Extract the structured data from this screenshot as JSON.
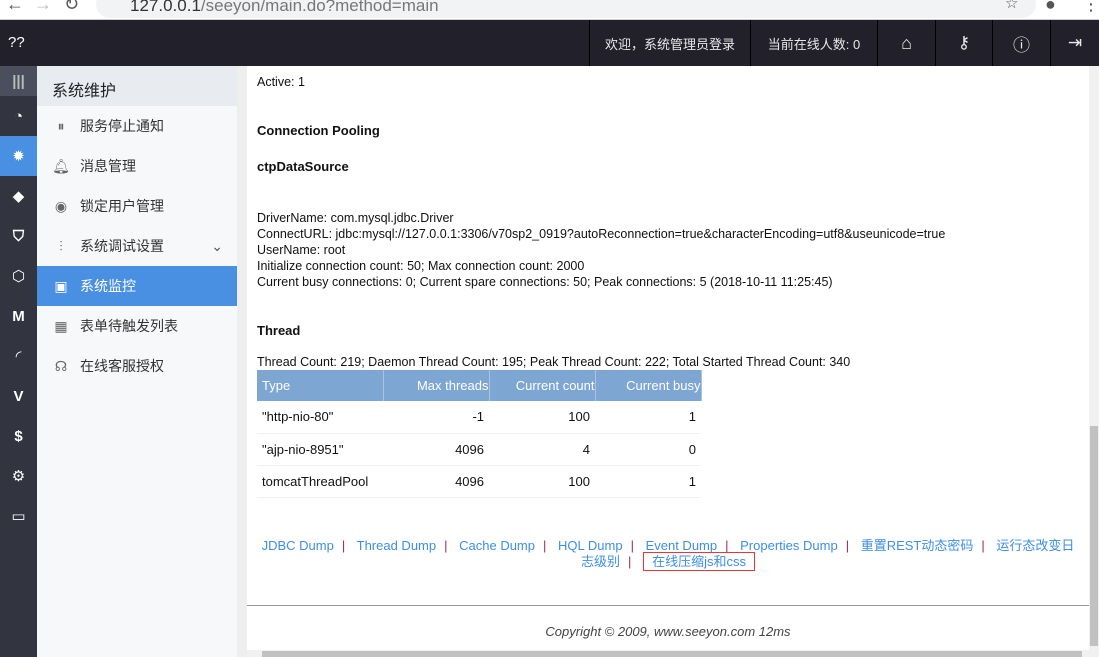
{
  "browser": {
    "url_host": "127.0.0.1",
    "url_path": "/seeyon/main.do?method=main"
  },
  "topbar": {
    "logo": "??",
    "welcome": "欢迎，系统管理员登录",
    "online": "当前在线人数: 0",
    "icons": [
      "home-icon",
      "key-icon",
      "help-icon",
      "logout-icon"
    ]
  },
  "rail": {
    "icons": [
      "menu-icon",
      "dashboard-icon",
      "gear-icon",
      "plugin-icon",
      "shield-icon",
      "hexagon-icon",
      "m-icon",
      "feather-icon",
      "v-icon",
      "s-icon",
      "plug-icon",
      "monitor-icon"
    ]
  },
  "sidebar": {
    "title": "系统维护",
    "items": [
      {
        "label": "服务停止通知",
        "icon": "pause-icon"
      },
      {
        "label": "消息管理",
        "icon": "bell-icon"
      },
      {
        "label": "锁定用户管理",
        "icon": "lock-icon"
      },
      {
        "label": "系统调试设置",
        "icon": "sliders-icon"
      },
      {
        "label": "系统监控",
        "icon": "monitor-wave-icon",
        "active": true
      },
      {
        "label": "表单待触发列表",
        "icon": "calendar-icon"
      },
      {
        "label": "在线客服授权",
        "icon": "support-icon"
      }
    ]
  },
  "main": {
    "active": "Active: 1",
    "pooling_title": "Connection Pooling",
    "ds_title": "ctpDataSource",
    "ds_lines": [
      "DriverName: com.mysql.jdbc.Driver",
      "ConnectURL: jdbc:mysql://127.0.0.1:3306/v70sp2_0919?autoReconnection=true&characterEncoding=utf8&useunicode=true",
      "UserName: root",
      "Initialize connection count: 50; Max connection count: 2000",
      "Current busy connections: 0; Current spare connections: 50; Peak connections: 5 (2018-10-11 11:25:45)"
    ],
    "thread_title": "Thread",
    "thread_summary": "Thread Count: 219; Daemon Thread Count: 195; Peak Thread Count: 222; Total Started Thread Count: 340",
    "table": {
      "headers": [
        "Type",
        "Max threads",
        "Current count",
        "Current busy"
      ],
      "rows": [
        [
          "\"http-nio-80\"",
          "-1",
          "100",
          "1"
        ],
        [
          "\"ajp-nio-8951\"",
          "4096",
          "4",
          "0"
        ],
        [
          "tomcatThreadPool",
          "4096",
          "100",
          "1"
        ]
      ]
    },
    "links": [
      "JDBC Dump",
      "Thread Dump",
      "Cache Dump",
      "HQL Dump",
      "Event Dump",
      "Properties Dump",
      "重置REST动态密码",
      "运行态改变日志级别",
      "在线压缩js和css"
    ],
    "separator": "|",
    "copyright": "Copyright © 2009, www.seeyon.com 12ms"
  },
  "colors": {
    "accent": "#4a90e2",
    "topbar": "#22212b",
    "rail": "#323540",
    "table_header": "#7ea6d3",
    "link": "#3d8ee6"
  }
}
